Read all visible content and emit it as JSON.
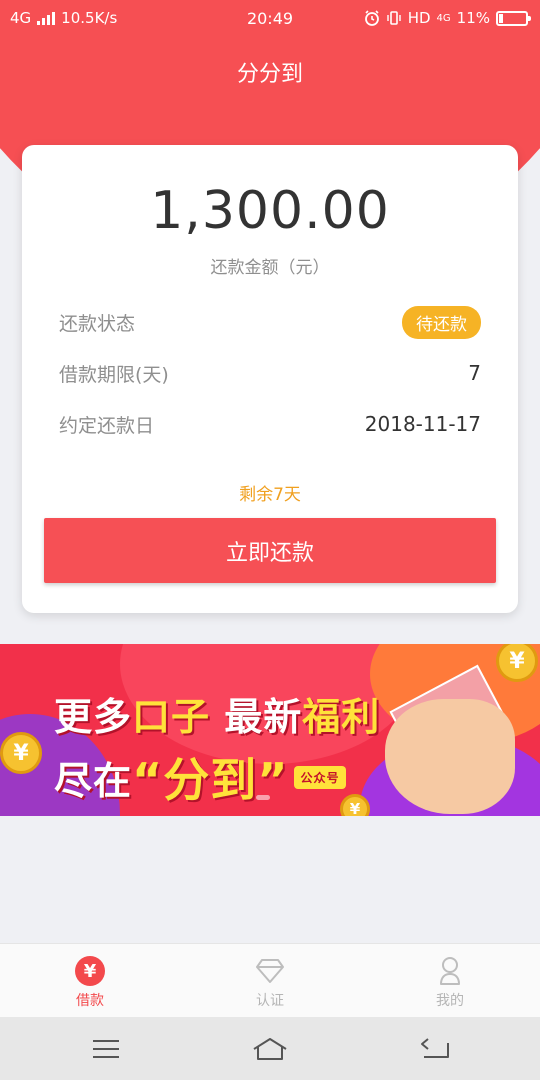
{
  "status_bar": {
    "network": "4G",
    "speed": "10.5K/s",
    "time": "20:49",
    "hd": "HD",
    "net2": "4G",
    "battery": "11%"
  },
  "header": {
    "title": "分分到"
  },
  "card": {
    "amount": "1,300.00",
    "amount_label": "还款金额（元）",
    "rows": [
      {
        "label": "还款状态",
        "value": "待还款"
      },
      {
        "label": "借款期限(天)",
        "value": "7"
      },
      {
        "label": "约定还款日",
        "value": "2018-11-17"
      }
    ],
    "remaining": "剩余7天",
    "pay_button": "立即还款"
  },
  "banner": {
    "line1_a": "更多",
    "line1_b": "口子",
    "line1_c": "最新",
    "line1_d": "福利",
    "line2_a": "尽在",
    "line2_b": "“分到”",
    "tag": "公众号",
    "coin_symbol": "¥"
  },
  "tabs": [
    {
      "label": "借款",
      "icon": "yen-icon",
      "active": true
    },
    {
      "label": "认证",
      "icon": "diamond-icon",
      "active": false
    },
    {
      "label": "我的",
      "icon": "person-icon",
      "active": false
    }
  ],
  "colors": {
    "brand": "#f64f53",
    "badge": "#f6b325",
    "remaining": "#f0a020"
  }
}
